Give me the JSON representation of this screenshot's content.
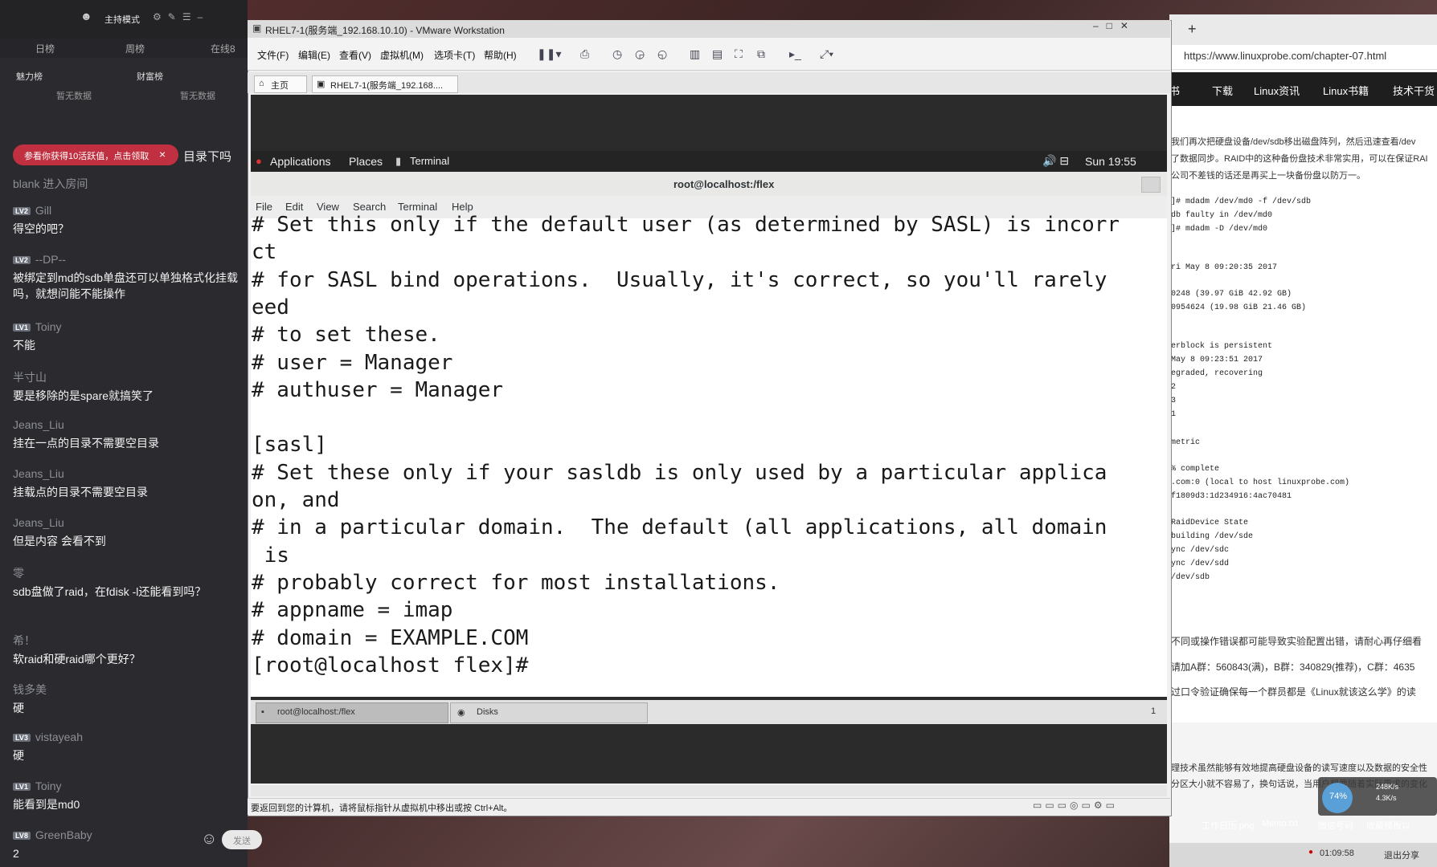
{
  "chat": {
    "host_mode": "主持模式",
    "tabs": [
      "日榜",
      "周榜",
      "在线8"
    ],
    "ranks": [
      "魅力榜",
      "财富榜"
    ],
    "no_data": [
      "暂无数据",
      "暂无数据"
    ],
    "gift_banner": "参看你获得10活跃值，点击领取",
    "gift_tail": "目录下吗",
    "join_notice": "blank 进入房间",
    "messages": [
      {
        "level": "LV2",
        "user": "Gill",
        "text": "得空的吧？"
      },
      {
        "level": "LV2",
        "user": "--DP--",
        "text": "被绑定到md的sdb单盘还可以单独格式化挂载吗，就想问能不能操作"
      },
      {
        "level": "LV1",
        "user": "Toiny",
        "text": "不能"
      },
      {
        "level": "",
        "user": "半寸山",
        "text": "要是移除的是spare就搞笑了"
      },
      {
        "level": "",
        "user": "Jeans_Liu",
        "text": "挂在一点的目录不需要空目录"
      },
      {
        "level": "",
        "user": "Jeans_Liu",
        "text": "挂载点的目录不需要空目录"
      },
      {
        "level": "",
        "user": "Jeans_Liu",
        "text": "但是内容 会看不到"
      },
      {
        "level": "",
        "user": "零",
        "text": "sdb盘做了raid，在fdisk -l还能看到吗？"
      },
      {
        "level": "",
        "user": "希！",
        "text": "软raid和硬raid哪个更好？"
      },
      {
        "level": "",
        "user": "钱多美",
        "text": "硬"
      },
      {
        "level": "LV3",
        "user": "vistayeah",
        "text": "硬"
      },
      {
        "level": "LV1",
        "user": "Toiny",
        "text": "能看到是md0"
      },
      {
        "level": "LV8",
        "user": "GreenBaby",
        "text": "2"
      }
    ],
    "send_label": "发送"
  },
  "vmware": {
    "title": "RHEL7-1(服务端_192.168.10.10) - VMware Workstation",
    "menu": [
      "文件(F)",
      "编辑(E)",
      "查看(V)",
      "虚拟机(M)",
      "选项卡(T)",
      "帮助(H)"
    ],
    "tab_home": "主页",
    "tab_vm": "RHEL7-1(服务端_192.168....",
    "status": "要返回到您的计算机，请将鼠标指针从虚拟机中移出或按 Ctrl+Alt。"
  },
  "gnome": {
    "applications": "Applications",
    "places": "Places",
    "terminal_tab": "Terminal",
    "clock": "Sun 19:55",
    "bottom_task1": "root@localhost:/flex",
    "bottom_task2": "Disks",
    "workspace": "1"
  },
  "terminal": {
    "title": "root@localhost:/flex",
    "menu": [
      "File",
      "Edit",
      "View",
      "Search",
      "Terminal",
      "Help"
    ],
    "lines": [
      "# Set this only if the default user (as determined by SASL) is incorr",
      "ct",
      "# for SASL bind operations.  Usually, it's correct, so you'll rarely",
      "eed",
      "# to set these.",
      "# user = Manager",
      "# authuser = Manager",
      "",
      "[sasl]",
      "# Set these only if your sasldb is only used by a particular applica",
      "on, and",
      "# in a particular domain.  The default (all applications, all domain",
      " is",
      "# probably correct for most installations.",
      "# appname = imap",
      "# domain = EXAMPLE.COM",
      "[root@localhost flex]#"
    ]
  },
  "browser": {
    "url": "https://www.linuxprobe.com/chapter-07.html",
    "nav": [
      "书",
      "下载",
      "Linux资讯",
      "Linux书籍",
      "技术干货"
    ],
    "text_lines": [
      "我们再次把硬盘设备/dev/sdb移出磁盘阵列，然后迅速查看/dev",
      "了数据同步。RAID中的这种备份盘技术非常实用，可以在保证RAI",
      "公司不差钱的话还是再买上一块备份盘以防万一。"
    ],
    "code_lines": [
      "]# mdadm /dev/md0 -f /dev/sdb",
      "db faulty in /dev/md0",
      "]# mdadm -D /dev/md0",
      "ri May 8 09:20:35 2017",
      "0248 (39.97 GiB 42.92 GB)",
      "0954624 (19.98 GiB 21.46 GB)",
      "erblock is persistent",
      " May 8 09:23:51 2017",
      "egraded, recovering",
      "2",
      "3",
      "1",
      "metric",
      "% complete",
      ".com:0 (local to host linuxprobe.com)",
      "f1809d3:1d234916:4ac70481",
      " RaidDevice State",
      "building /dev/sde",
      "ync /dev/sdc",
      "ync /dev/sdd",
      "/dev/sdb"
    ],
    "bottom_lines": [
      "不同或操作错误都可能导致实验配置出错，请耐心再仔细看",
      "请加A群：560843(满)，B群：340829(推荐)，C群：4635",
      "过口令验证确保每一个群员都是《Linux就该这么学》的读",
      "理技术虽然能够有效地提高硬盘设备的读写速度以及数据的安全性",
      "分区大小就不容易了，换句话说，当用户想要随着实际需求的变化"
    ],
    "download_pct": "74%",
    "speeds": [
      "248K/s",
      "4.3K/s"
    ],
    "desktop_icons": [
      "工作日历.png",
      "Memo.txt",
      "微信号码",
      "收藏模板以"
    ],
    "timer": "01:09:58",
    "exit_share": "退出分享"
  }
}
